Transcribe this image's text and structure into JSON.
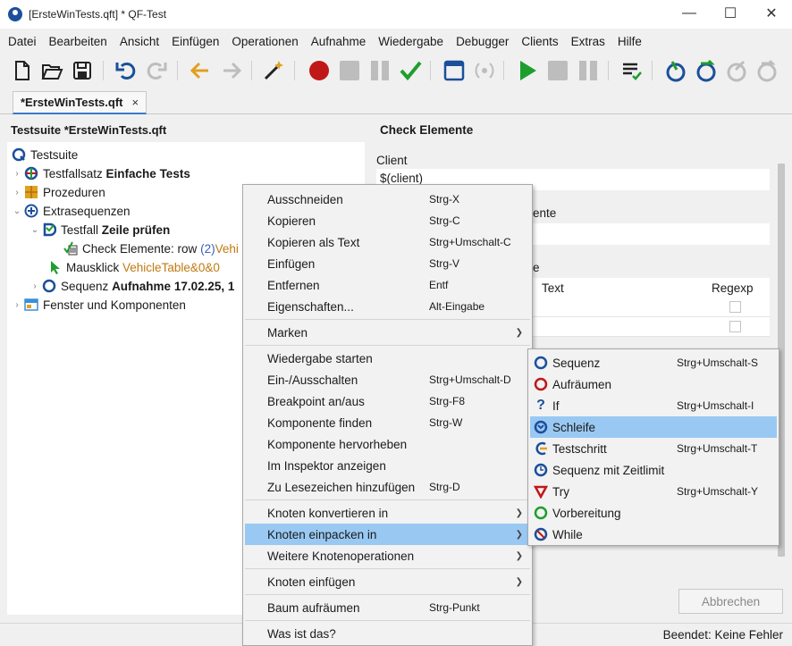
{
  "window": {
    "title": "[ErsteWinTests.qft] * QF-Test",
    "minimize": "—",
    "maximize": "☐",
    "close": "✕"
  },
  "menubar": [
    "Datei",
    "Bearbeiten",
    "Ansicht",
    "Einfügen",
    "Operationen",
    "Aufnahme",
    "Wiedergabe",
    "Debugger",
    "Clients",
    "Extras",
    "Hilfe"
  ],
  "tab": {
    "label": "*ErsteWinTests.qft",
    "close": "×"
  },
  "tree": {
    "header": "Testsuite *ErsteWinTests.qft",
    "root": "Testsuite",
    "testset_prefix": "Testfallsatz ",
    "testset_name": "Einfache Tests",
    "procedures": "Prozeduren",
    "extras": "Extrasequenzen",
    "testcase_prefix": "Testfall ",
    "testcase_name": "Zeile prüfen",
    "check_prefix": "Check Elemente: row ",
    "check_num": "(2)",
    "check_target": " Vehi",
    "click_prefix": "Mausklick ",
    "click_target": "VehicleTable&0&0",
    "seq_prefix": "Sequenz ",
    "seq_name": "Aufnahme 17.02.25, 1",
    "windows": "Fenster und Komponenten"
  },
  "detail": {
    "title": "Check Elemente",
    "client_label": "Client",
    "client_value": "$(client)",
    "component_label_tail": "ente",
    "items_label_tail": "e",
    "col_text": "Text",
    "col_regexp": "Regexp",
    "cancel": "Abbrechen"
  },
  "status": "Beendet: Keine Fehler",
  "context_menu": [
    {
      "label": "Ausschneiden",
      "acc": "Strg-X"
    },
    {
      "label": "Kopieren",
      "acc": "Strg-C"
    },
    {
      "label": "Kopieren als Text",
      "acc": "Strg+Umschalt-C"
    },
    {
      "label": "Einfügen",
      "acc": "Strg-V"
    },
    {
      "label": "Entfernen",
      "acc": "Entf"
    },
    {
      "label": "Eigenschaften...",
      "acc": "Alt-Eingabe"
    },
    {
      "label": "Marken",
      "acc": ""
    },
    {
      "label": "Wiedergabe starten",
      "acc": ""
    },
    {
      "label": "Ein-/Ausschalten",
      "acc": "Strg+Umschalt-D"
    },
    {
      "label": "Breakpoint an/aus",
      "acc": "Strg-F8"
    },
    {
      "label": "Komponente finden",
      "acc": "Strg-W"
    },
    {
      "label": "Komponente hervorheben",
      "acc": ""
    },
    {
      "label": "Im Inspektor anzeigen",
      "acc": ""
    },
    {
      "label": "Zu Lesezeichen hinzufügen",
      "acc": "Strg-D"
    },
    {
      "label": "Knoten konvertieren in",
      "acc": ""
    },
    {
      "label": "Knoten einpacken in",
      "acc": ""
    },
    {
      "label": "Weitere Knotenoperationen",
      "acc": ""
    },
    {
      "label": "Knoten einfügen",
      "acc": ""
    },
    {
      "label": "Baum aufräumen",
      "acc": "Strg-Punkt"
    },
    {
      "label": "Was ist das?",
      "acc": ""
    }
  ],
  "submenu": [
    {
      "label": "Sequenz",
      "acc": "Strg+Umschalt-S",
      "icon": "sequence-icon"
    },
    {
      "label": "Aufräumen",
      "acc": "",
      "icon": "cleanup-icon"
    },
    {
      "label": "If",
      "acc": "Strg+Umschalt-I",
      "icon": "if-icon"
    },
    {
      "label": "Schleife",
      "acc": "",
      "icon": "loop-icon"
    },
    {
      "label": "Testschritt",
      "acc": "Strg+Umschalt-T",
      "icon": "teststep-icon"
    },
    {
      "label": "Sequenz mit Zeitlimit",
      "acc": "",
      "icon": "timed-sequence-icon"
    },
    {
      "label": "Try",
      "acc": "Strg+Umschalt-Y",
      "icon": "try-icon"
    },
    {
      "label": "Vorbereitung",
      "acc": "",
      "icon": "setup-icon"
    },
    {
      "label": "While",
      "acc": "",
      "icon": "while-icon"
    }
  ],
  "colors": {
    "selection": "#99c9f3",
    "accent_blue": "#1b4f9c",
    "record_red": "#c01818",
    "play_green": "#1e9e2e",
    "arrow_orange": "#e0a020"
  }
}
